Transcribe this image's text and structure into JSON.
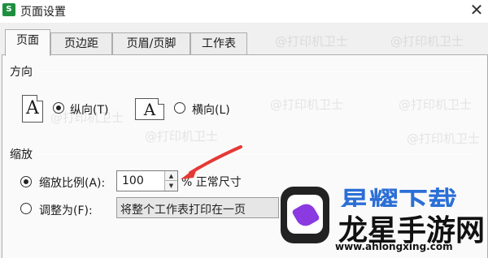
{
  "window": {
    "title": "页面设置",
    "app_icon_glyph": "S",
    "close_glyph": "✕"
  },
  "tabs": [
    {
      "label": "页面",
      "active": true
    },
    {
      "label": "页边距",
      "active": false
    },
    {
      "label": "页眉/页脚",
      "active": false
    },
    {
      "label": "工作表",
      "active": false
    }
  ],
  "orientation": {
    "section_label": "方向",
    "icon_letter": "A",
    "portrait_label": "纵向(T)",
    "landscape_label": "横向(L)",
    "selected": "portrait"
  },
  "scaling": {
    "section_label": "缩放",
    "scale_label": "缩放比例(A):",
    "scale_value": "100",
    "scale_unit": "% 正常尺寸",
    "adjust_label": "调整为(F):",
    "adjust_value": "将整个工作表打印在一页",
    "selected": "scale"
  },
  "annotation": {
    "arrow_color": "#e53935"
  },
  "watermarks": {
    "repeated": "@打印机卫士",
    "brand_top": "星耀下载",
    "brand_cn": "龙星手游网",
    "brand_url": "www.ahlongxing.com"
  },
  "icons": [
    "app-icon",
    "close-icon",
    "portrait-page-icon",
    "landscape-page-icon",
    "spin-up-icon",
    "spin-down-icon"
  ]
}
